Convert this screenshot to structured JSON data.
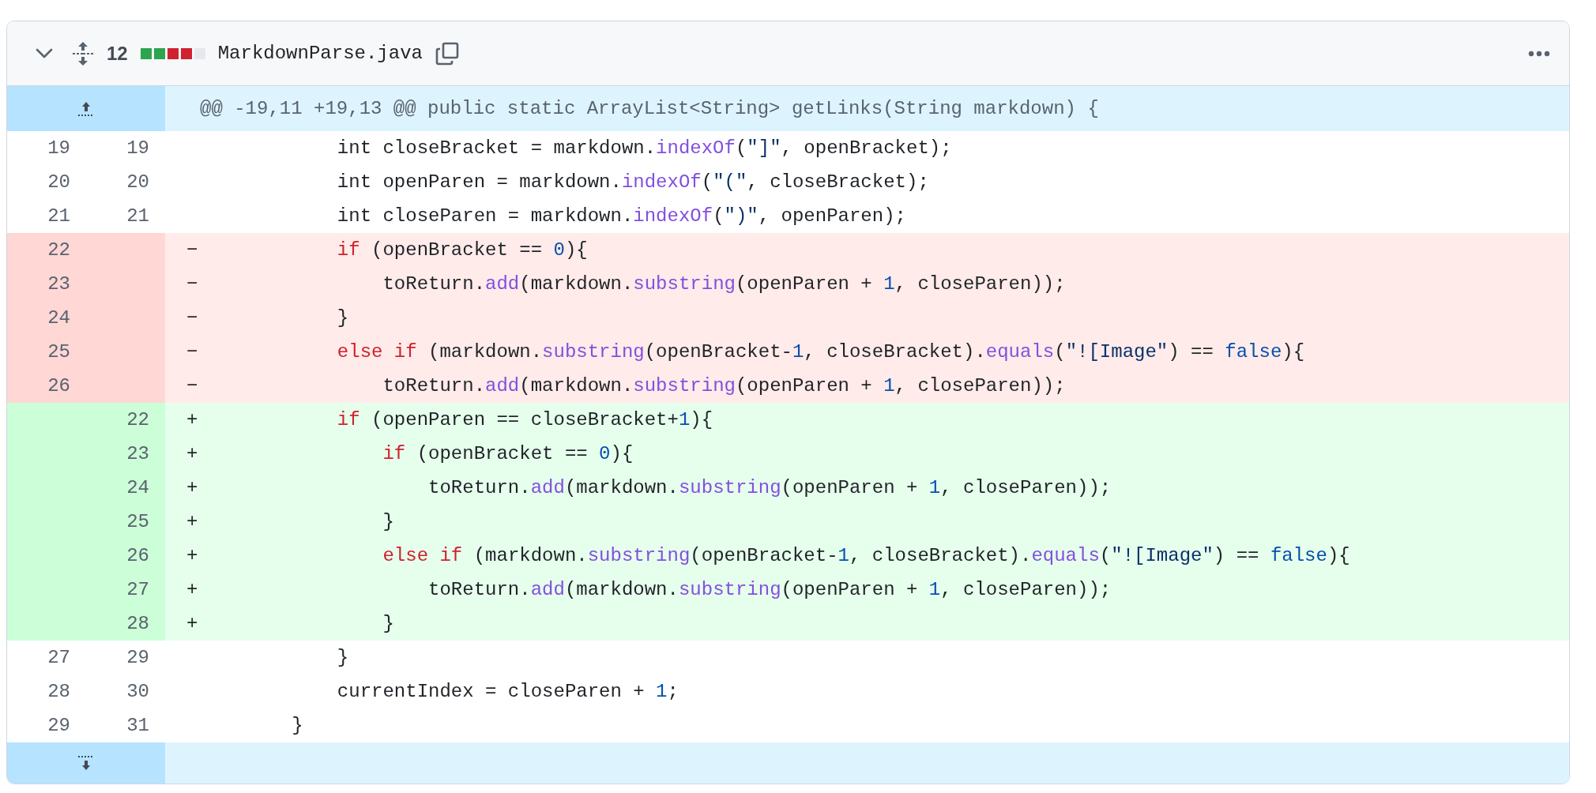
{
  "file_header": {
    "changes": "12",
    "diffstat": [
      {
        "color": "#2da44e"
      },
      {
        "color": "#2da44e"
      },
      {
        "color": "#cf222e"
      },
      {
        "color": "#cf222e"
      },
      {
        "color": "#e6e8eb"
      }
    ],
    "filename": "MarkdownParse.java"
  },
  "hunk_header": "@@ -19,11 +19,13 @@ public static ArrayList<String> getLinks(String markdown) {",
  "lines": [
    {
      "kind": "context",
      "old": "19",
      "new": "19",
      "code": [
        {
          "kind": "plain",
          "text": "            int closeBracket = markdown."
        },
        {
          "kind": "function",
          "text": "indexOf"
        },
        {
          "kind": "plain",
          "text": "("
        },
        {
          "kind": "string",
          "text": "\"]\""
        },
        {
          "kind": "plain",
          "text": ", openBracket);"
        }
      ]
    },
    {
      "kind": "context",
      "old": "20",
      "new": "20",
      "code": [
        {
          "kind": "plain",
          "text": "            int openParen = markdown."
        },
        {
          "kind": "function",
          "text": "indexOf"
        },
        {
          "kind": "plain",
          "text": "("
        },
        {
          "kind": "string",
          "text": "\"(\""
        },
        {
          "kind": "plain",
          "text": ", closeBracket);"
        }
      ]
    },
    {
      "kind": "context",
      "old": "21",
      "new": "21",
      "code": [
        {
          "kind": "plain",
          "text": "            int closeParen = markdown."
        },
        {
          "kind": "function",
          "text": "indexOf"
        },
        {
          "kind": "plain",
          "text": "("
        },
        {
          "kind": "string",
          "text": "\")\""
        },
        {
          "kind": "plain",
          "text": ", openParen);"
        }
      ]
    },
    {
      "kind": "deletion",
      "old": "22",
      "sign": "−",
      "code": [
        {
          "kind": "keyword",
          "text": "            if"
        },
        {
          "kind": "plain",
          "text": " (openBracket == "
        },
        {
          "kind": "constant",
          "text": "0"
        },
        {
          "kind": "plain",
          "text": "){"
        }
      ]
    },
    {
      "kind": "deletion",
      "old": "23",
      "sign": "−",
      "code": [
        {
          "kind": "plain",
          "text": "                toReturn."
        },
        {
          "kind": "function",
          "text": "add"
        },
        {
          "kind": "plain",
          "text": "(markdown."
        },
        {
          "kind": "function",
          "text": "substring"
        },
        {
          "kind": "plain",
          "text": "(openParen + "
        },
        {
          "kind": "constant",
          "text": "1"
        },
        {
          "kind": "plain",
          "text": ", closeParen));"
        }
      ]
    },
    {
      "kind": "deletion",
      "old": "24",
      "sign": "−",
      "code": [
        {
          "kind": "plain",
          "text": "            }"
        }
      ]
    },
    {
      "kind": "deletion",
      "old": "25",
      "sign": "−",
      "code": [
        {
          "kind": "keyword",
          "text": "            else if"
        },
        {
          "kind": "plain",
          "text": " (markdown."
        },
        {
          "kind": "function",
          "text": "substring"
        },
        {
          "kind": "plain",
          "text": "(openBracket-"
        },
        {
          "kind": "constant",
          "text": "1"
        },
        {
          "kind": "plain",
          "text": ", closeBracket)."
        },
        {
          "kind": "function",
          "text": "equals"
        },
        {
          "kind": "plain",
          "text": "("
        },
        {
          "kind": "string",
          "text": "\"![Image\""
        },
        {
          "kind": "plain",
          "text": ") == "
        },
        {
          "kind": "constant",
          "text": "false"
        },
        {
          "kind": "plain",
          "text": "){"
        }
      ]
    },
    {
      "kind": "deletion",
      "old": "26",
      "sign": "−",
      "code": [
        {
          "kind": "plain",
          "text": "                toReturn."
        },
        {
          "kind": "function",
          "text": "add"
        },
        {
          "kind": "plain",
          "text": "(markdown."
        },
        {
          "kind": "function",
          "text": "substring"
        },
        {
          "kind": "plain",
          "text": "(openParen + "
        },
        {
          "kind": "constant",
          "text": "1"
        },
        {
          "kind": "plain",
          "text": ", closeParen));"
        }
      ]
    },
    {
      "kind": "addition",
      "new": "22",
      "sign": "+",
      "code": [
        {
          "kind": "keyword",
          "text": "            if"
        },
        {
          "kind": "plain",
          "text": " (openParen == closeBracket+"
        },
        {
          "kind": "constant",
          "text": "1"
        },
        {
          "kind": "plain",
          "text": "){"
        }
      ]
    },
    {
      "kind": "addition",
      "new": "23",
      "sign": "+",
      "code": [
        {
          "kind": "keyword",
          "text": "                if"
        },
        {
          "kind": "plain",
          "text": " (openBracket == "
        },
        {
          "kind": "constant",
          "text": "0"
        },
        {
          "kind": "plain",
          "text": "){"
        }
      ]
    },
    {
      "kind": "addition",
      "new": "24",
      "sign": "+",
      "code": [
        {
          "kind": "plain",
          "text": "                    toReturn."
        },
        {
          "kind": "function",
          "text": "add"
        },
        {
          "kind": "plain",
          "text": "(markdown."
        },
        {
          "kind": "function",
          "text": "substring"
        },
        {
          "kind": "plain",
          "text": "(openParen + "
        },
        {
          "kind": "constant",
          "text": "1"
        },
        {
          "kind": "plain",
          "text": ", closeParen));"
        }
      ]
    },
    {
      "kind": "addition",
      "new": "25",
      "sign": "+",
      "code": [
        {
          "kind": "plain",
          "text": "                }"
        }
      ]
    },
    {
      "kind": "addition",
      "new": "26",
      "sign": "+",
      "code": [
        {
          "kind": "keyword",
          "text": "                else if"
        },
        {
          "kind": "plain",
          "text": " (markdown."
        },
        {
          "kind": "function",
          "text": "substring"
        },
        {
          "kind": "plain",
          "text": "(openBracket-"
        },
        {
          "kind": "constant",
          "text": "1"
        },
        {
          "kind": "plain",
          "text": ", closeBracket)."
        },
        {
          "kind": "function",
          "text": "equals"
        },
        {
          "kind": "plain",
          "text": "("
        },
        {
          "kind": "string",
          "text": "\"![Image\""
        },
        {
          "kind": "plain",
          "text": ") == "
        },
        {
          "kind": "constant",
          "text": "false"
        },
        {
          "kind": "plain",
          "text": "){"
        }
      ]
    },
    {
      "kind": "addition",
      "new": "27",
      "sign": "+",
      "code": [
        {
          "kind": "plain",
          "text": "                    toReturn."
        },
        {
          "kind": "function",
          "text": "add"
        },
        {
          "kind": "plain",
          "text": "(markdown."
        },
        {
          "kind": "function",
          "text": "substring"
        },
        {
          "kind": "plain",
          "text": "(openParen + "
        },
        {
          "kind": "constant",
          "text": "1"
        },
        {
          "kind": "plain",
          "text": ", closeParen));"
        }
      ]
    },
    {
      "kind": "addition",
      "new": "28",
      "sign": "+",
      "code": [
        {
          "kind": "plain",
          "text": "                }"
        }
      ]
    },
    {
      "kind": "context",
      "old": "27",
      "new": "29",
      "code": [
        {
          "kind": "plain",
          "text": "            }"
        }
      ]
    },
    {
      "kind": "context",
      "old": "28",
      "new": "30",
      "code": [
        {
          "kind": "plain",
          "text": "            currentIndex = closeParen + "
        },
        {
          "kind": "constant",
          "text": "1"
        },
        {
          "kind": "plain",
          "text": ";"
        }
      ]
    },
    {
      "kind": "context",
      "old": "29",
      "new": "31",
      "code": [
        {
          "kind": "plain",
          "text": "        }"
        }
      ]
    }
  ]
}
